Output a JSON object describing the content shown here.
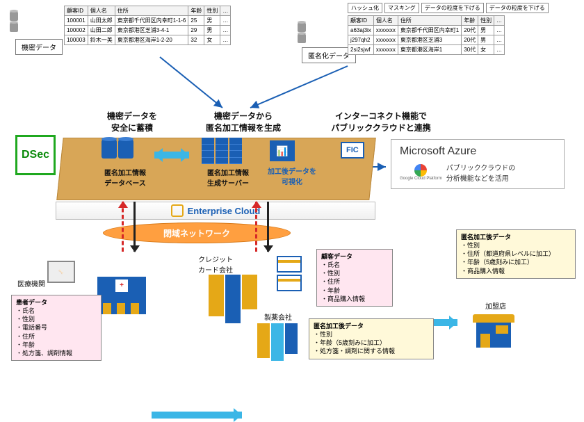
{
  "tables": {
    "confidential": {
      "headers": [
        "顧客ID",
        "個人名",
        "住所",
        "年齢",
        "性別",
        "…"
      ],
      "rows": [
        [
          "100001",
          "山田太郎",
          "東京都千代田区内幸町1-1-6",
          "25",
          "男",
          "…"
        ],
        [
          "100002",
          "山田二郎",
          "東京都港区芝浦3-4-1",
          "29",
          "男",
          "…"
        ],
        [
          "100003",
          "鈴木一美",
          "東京都港区海岸1-2-20",
          "32",
          "女",
          "…"
        ]
      ]
    },
    "anonymized": {
      "tags": [
        "ハッシュ化",
        "マスキング",
        "データの粒度を下げる",
        "データの粒度を下げる"
      ],
      "headers": [
        "顧客ID",
        "個人名",
        "住所",
        "年齢",
        "性別",
        "…"
      ],
      "rows": [
        [
          "a63aj3ix",
          "xxxxxxx",
          "東京都千代田区内幸町1",
          "20代",
          "男",
          "…"
        ],
        [
          "j297qh2",
          "xxxxxxx",
          "東京都港区芝浦3",
          "20代",
          "男",
          "…"
        ],
        [
          "2si2sjwf",
          "xxxxxxx",
          "東京都港区海岸1",
          "30代",
          "女",
          "…"
        ]
      ]
    }
  },
  "labels": {
    "confidential_data": "機密データ",
    "anonymized_data": "匿名化データ"
  },
  "headings": {
    "store_safely": "機密データを\n安全に蓄積",
    "generate_anon": "機密データから\n匿名加工情報を生成",
    "interconnect": "インターコネクト機能で\nパブリッククラウドと連携"
  },
  "platform": {
    "db_caption": "匿名加工情報\nデータベース",
    "server_caption": "匿名加工情報\n生成サーバー",
    "vis_caption": "加工後データを\n可視化",
    "fic": "FIC",
    "ec_name": "Enterprise Cloud",
    "closed_net": "閉域ネットワーク",
    "dsec": "DSec"
  },
  "cloud": {
    "azure": "Microsoft Azure",
    "gcp_label": "Google Cloud Platform",
    "desc": "パブリッククラウドの\n分析機能などを活用"
  },
  "entities": {
    "medical": "医療機関",
    "credit": "クレジット\nカード会社",
    "pharma": "製薬会社",
    "merchant": "加盟店"
  },
  "boxes": {
    "patient_data": {
      "title": "患者データ",
      "items": [
        "氏名",
        "性別",
        "電話番号",
        "住所",
        "年齢",
        "処方箋、調剤情報"
      ]
    },
    "customer_data": {
      "title": "顧客データ",
      "items": [
        "氏名",
        "性別",
        "住所",
        "年齢",
        "商品購入情報"
      ]
    },
    "anon_after_pharma": {
      "title": "匿名加工後データ",
      "items": [
        "性別",
        "年齢（5歳刻みに加工）",
        "処方箋・調剤に関する情報"
      ]
    },
    "anon_after_merchant": {
      "title": "匿名加工後データ",
      "items": [
        "性別",
        "住所（都道府県レベルに加工）",
        "年齢（5歳刻みに加工）",
        "商品購入情報"
      ]
    }
  }
}
